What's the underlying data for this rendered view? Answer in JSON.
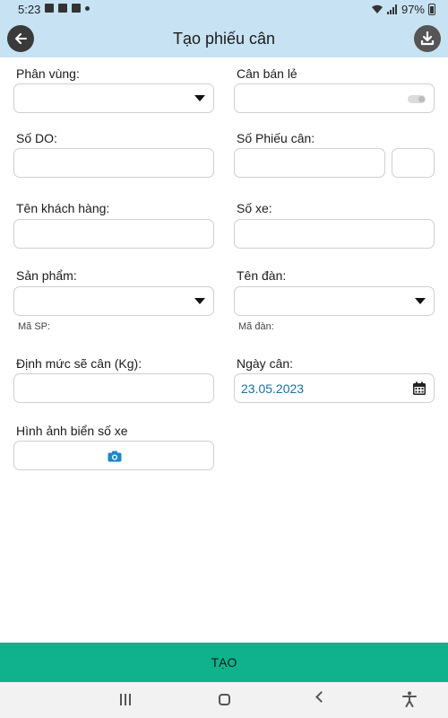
{
  "status_bar": {
    "time": "5:23",
    "battery": "97%"
  },
  "header": {
    "title": "Tạo phiếu cân"
  },
  "form": {
    "phan_vung": {
      "label": "Phân vùng:"
    },
    "can_ban_le": {
      "label": "Cân bán lẻ"
    },
    "so_do": {
      "label": "Số DO:"
    },
    "so_phieu_can": {
      "label": "Số Phiếu cân:"
    },
    "ten_khach_hang": {
      "label": "Tên khách hàng:"
    },
    "so_xe": {
      "label": "Số xe:"
    },
    "san_pham": {
      "label": "Sản phẩm:",
      "sub_label": "Mã SP:"
    },
    "ten_dan": {
      "label": "Tên đàn:",
      "sub_label": "Mã đàn:"
    },
    "dinh_muc": {
      "label": "Định mức sẽ cân (Kg):"
    },
    "ngay_can": {
      "label": "Ngày cân:",
      "value": "23.05.2023"
    },
    "hinh_anh": {
      "label": "Hình ảnh biển số xe"
    }
  },
  "actions": {
    "create_label": "TẠO"
  },
  "icons": {
    "back": "arrow-left-icon",
    "download": "download-icon",
    "calendar": "calendar-icon",
    "camera": "camera-icon",
    "dropdown": "caret-down-icon"
  },
  "colors": {
    "header_bg": "#c7e3f3",
    "create_button_bg": "#0fb28c",
    "date_text": "#1a6fa3",
    "camera_icon": "#1c86c8"
  }
}
